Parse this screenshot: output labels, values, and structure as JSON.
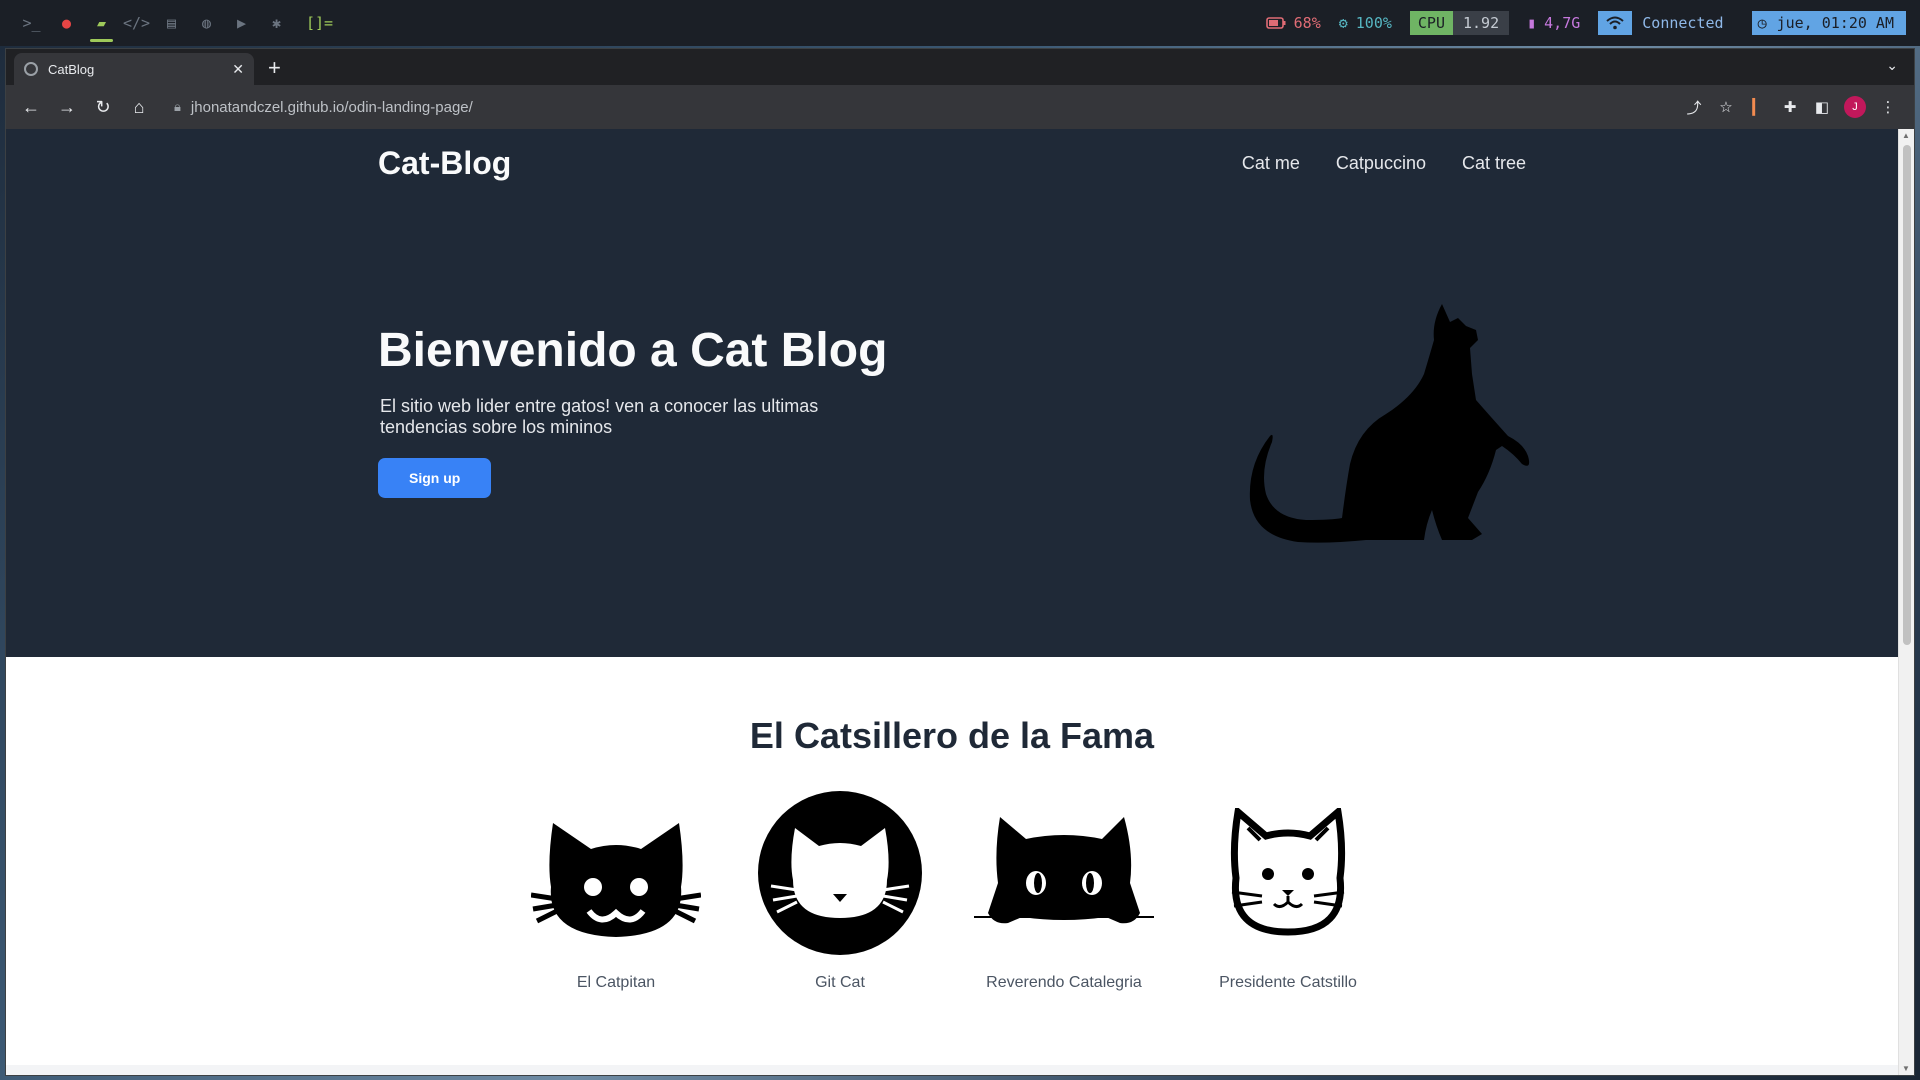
{
  "system_bar": {
    "workspace_icons": [
      "terminal-icon",
      "firefox-icon",
      "folder-icon",
      "code-icon",
      "notes-icon",
      "chat-icon",
      "video-icon",
      "settings-icon"
    ],
    "layout_indicator": "[]=",
    "battery": "68%",
    "cpu_freq": "100%",
    "cpu_label": "CPU",
    "cpu_load": "1.92",
    "memory": "4,7G",
    "network": "Connected",
    "clock": "jue, 01:20 AM",
    "colors": {
      "bar_bg": "#1b1f26",
      "active_ws": "#9ec95a",
      "cpu_label_bg": "#6fb464",
      "clock_bg": "#61a4e4"
    }
  },
  "browser": {
    "tab_title": "CatBlog",
    "url": "jhonatandczel.github.io/odin-landing-page/"
  },
  "page": {
    "logo": "Cat-Blog",
    "nav": [
      "Cat me",
      "Catpuccino",
      "Cat tree"
    ],
    "hero_title": "Bienvenido a Cat Blog",
    "hero_subtitle": "El sitio web lider entre gatos! ven a conocer las ultimas tendencias sobre los mininos",
    "signup_label": "Sign up",
    "fame_title": "El Catsillero de la Fama",
    "cats": [
      {
        "name": "El Catpitan",
        "icon": "smiling-cat-face-icon"
      },
      {
        "name": "Git Cat",
        "icon": "cat-circle-icon"
      },
      {
        "name": "Reverendo Catalegria",
        "icon": "peeking-cat-icon"
      },
      {
        "name": "Presidente Catstillo",
        "icon": "outline-cat-face-icon"
      }
    ],
    "colors": {
      "hero_bg": "#1f2937",
      "button": "#3882f6",
      "text_dark": "#1f2937"
    }
  }
}
